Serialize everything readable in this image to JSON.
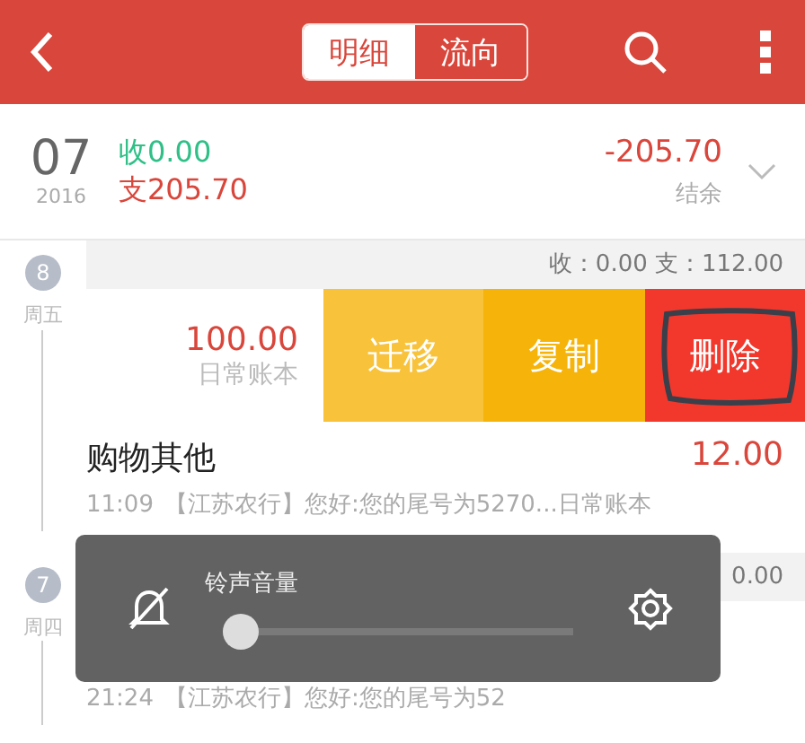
{
  "header": {
    "tabs": [
      {
        "label": "明细",
        "selected": true
      },
      {
        "label": "流向",
        "selected": false
      }
    ]
  },
  "summary": {
    "day": "07",
    "year": "2016",
    "income": "收0.00",
    "expense": "支205.70",
    "balance": "-205.70",
    "balance_label": "结余"
  },
  "days": [
    {
      "badge": "8",
      "weekday": "周五",
      "totals": "收：0.00 支：112.00",
      "entries": [
        {
          "kind": "swiped",
          "amount": "100.00",
          "book": "日常账本",
          "actions": [
            {
              "label": "迁移",
              "color": "#f8c23a"
            },
            {
              "label": "复制",
              "color": "#f6b40a"
            },
            {
              "label": "删除",
              "color": "#f2382c",
              "circled": true
            }
          ]
        },
        {
          "kind": "plain",
          "title": "购物其他",
          "amount": "12.00",
          "time": "11:09",
          "note": "【江苏农行】您好:您的尾号为5270...日常账本"
        }
      ]
    },
    {
      "badge": "7",
      "weekday": "周四",
      "totals": "0.00",
      "entries": [
        {
          "kind": "plain",
          "time": "21:24",
          "note": "【江苏农行】您好:您的尾号为52"
        }
      ]
    }
  ],
  "volume_panel": {
    "label": "铃声音量",
    "level": 0
  }
}
